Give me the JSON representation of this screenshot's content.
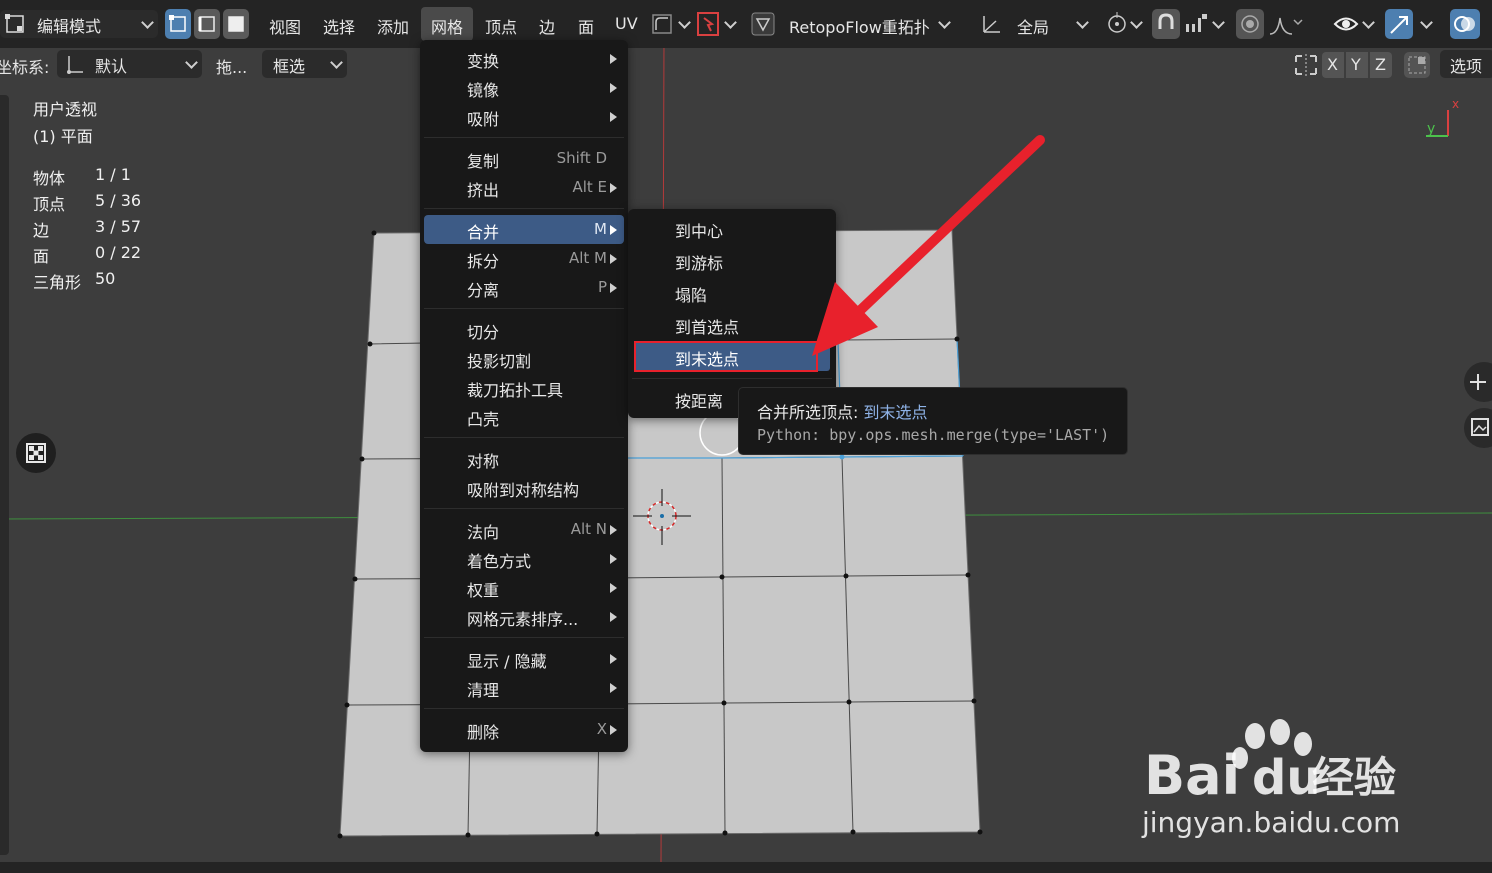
{
  "header": {
    "mode_label": "编辑模式",
    "menus": [
      "视图",
      "选择",
      "添加",
      "网格",
      "顶点",
      "边",
      "面",
      "UV"
    ],
    "addon_label": "RetopoFlow重拓扑",
    "pivot_label": "全局"
  },
  "toolbar": {
    "coord_label": "坐标系:",
    "coord_value": "默认",
    "drag_label": "拖...",
    "select_value": "框选",
    "axes": [
      "X",
      "Y",
      "Z"
    ],
    "options_label": "选项"
  },
  "overlay": {
    "view_name": "用户透视",
    "object_name": "(1) 平面",
    "stats": [
      {
        "key": "物体",
        "value": "1 / 1"
      },
      {
        "key": "顶点",
        "value": "5 / 36"
      },
      {
        "key": "边",
        "value": "3 / 57"
      },
      {
        "key": "面",
        "value": "0 / 22"
      },
      {
        "key": "三角形",
        "value": "50"
      }
    ]
  },
  "gizmo": {
    "x_label": "x",
    "y_label": "y"
  },
  "mesh_menu": {
    "items": [
      {
        "label": "变换",
        "shortcut": "",
        "submenu": true
      },
      {
        "label": "镜像",
        "shortcut": "",
        "submenu": true
      },
      {
        "label": "吸附",
        "shortcut": "",
        "submenu": true
      },
      {
        "label": "复制",
        "shortcut": "Shift D",
        "submenu": false
      },
      {
        "label": "挤出",
        "shortcut": "Alt E",
        "submenu": true
      },
      {
        "label": "合并",
        "shortcut": "M",
        "submenu": true
      },
      {
        "label": "拆分",
        "shortcut": "Alt M",
        "submenu": true
      },
      {
        "label": "分离",
        "shortcut": "P",
        "submenu": true
      },
      {
        "label": "切分",
        "shortcut": "",
        "submenu": false
      },
      {
        "label": "投影切割",
        "shortcut": "",
        "submenu": false
      },
      {
        "label": "裁刀拓扑工具",
        "shortcut": "",
        "submenu": false
      },
      {
        "label": "凸壳",
        "shortcut": "",
        "submenu": false
      },
      {
        "label": "对称",
        "shortcut": "",
        "submenu": false
      },
      {
        "label": "吸附到对称结构",
        "shortcut": "",
        "submenu": false
      },
      {
        "label": "法向",
        "shortcut": "Alt N",
        "submenu": true
      },
      {
        "label": "着色方式",
        "shortcut": "",
        "submenu": true
      },
      {
        "label": "权重",
        "shortcut": "",
        "submenu": true
      },
      {
        "label": "网格元素排序...",
        "shortcut": "",
        "submenu": true
      },
      {
        "label": "显示 / 隐藏",
        "shortcut": "",
        "submenu": true
      },
      {
        "label": "清理",
        "shortcut": "",
        "submenu": true
      },
      {
        "label": "删除",
        "shortcut": "X",
        "submenu": true
      }
    ]
  },
  "merge_menu": {
    "items": [
      {
        "label": "到中心"
      },
      {
        "label": "到游标"
      },
      {
        "label": "塌陷"
      },
      {
        "label": "到首选点"
      },
      {
        "label": "到末选点"
      },
      {
        "label": "按距离"
      }
    ]
  },
  "tooltip": {
    "prefix": "合并所选顶点: ",
    "value": "到末选点",
    "python": "Python: bpy.ops.mesh.merge(type='LAST')"
  },
  "watermark": {
    "brand": "Bai",
    "brand2": "经验",
    "url": "jingyan.baidu.com"
  },
  "colors": {
    "highlight": "#3d5b86",
    "annotation_red": "#e8212c",
    "menu_bg": "#181818"
  }
}
